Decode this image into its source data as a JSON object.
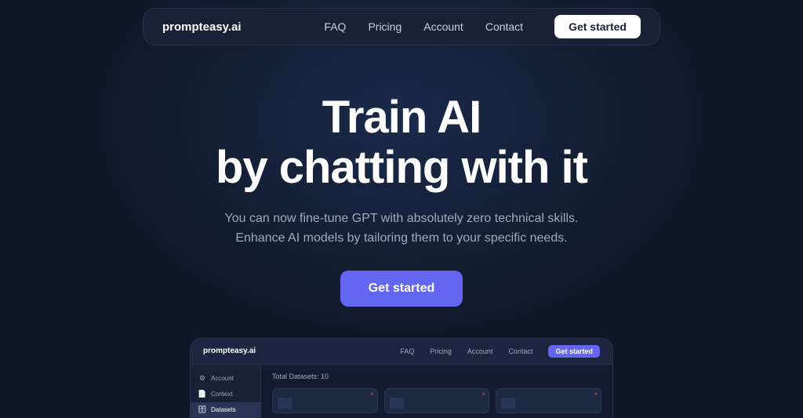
{
  "brand": {
    "name": "prompteasy.ai"
  },
  "navbar": {
    "links": [
      "FAQ",
      "Pricing",
      "Account",
      "Contact"
    ],
    "cta_label": "Get started"
  },
  "hero": {
    "title_line1": "Train AI",
    "title_line2": "by chatting with it",
    "subtitle_line1": "You can now fine-tune GPT with absolutely zero technical skills.",
    "subtitle_line2": "Enhance AI models by tailoring them to your specific needs.",
    "cta_label": "Get started"
  },
  "preview": {
    "brand": "prompteasy.ai",
    "nav_links": [
      "FAQ",
      "Pricing",
      "Account",
      "Contact"
    ],
    "cta_label": "Get started",
    "sidebar_items": [
      {
        "label": "Account",
        "icon": "⚙"
      },
      {
        "label": "Context",
        "icon": "📄"
      },
      {
        "label": "Datasets",
        "icon": "🗄",
        "active": true
      }
    ],
    "total_datasets": "Total Datasets: 10",
    "cards": [
      {
        "close": "×"
      },
      {
        "close": "×"
      },
      {
        "close": "×"
      }
    ]
  },
  "colors": {
    "accent": "#6366f1",
    "background": "#0f1624",
    "nav_bg": "#1a2035",
    "text_muted": "#a0aabf"
  }
}
